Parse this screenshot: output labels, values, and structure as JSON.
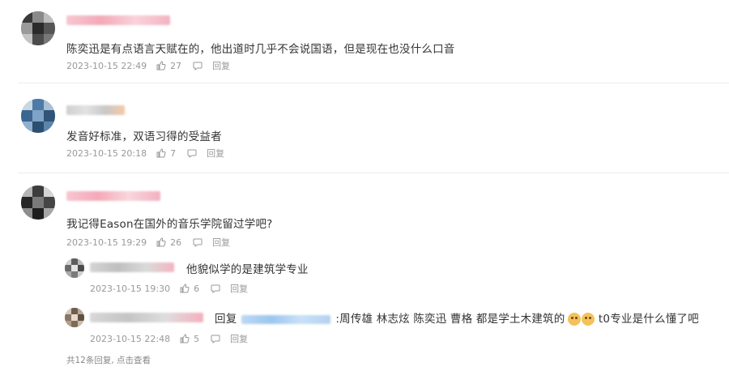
{
  "comments": [
    {
      "text": "陈奕迅是有点语言天赋在的，他出道时几乎不会说国语，但是现在也没什么口音",
      "date": "2023-10-15 22:49",
      "likes": "27",
      "reply_label": "回复"
    },
    {
      "text": "发音好标准，双语习得的受益者",
      "date": "2023-10-15 20:18",
      "likes": "7",
      "reply_label": "回复"
    },
    {
      "text": "我记得Eason在国外的音乐学院留过学吧?",
      "date": "2023-10-15 19:29",
      "likes": "26",
      "reply_label": "回复",
      "replies": [
        {
          "text": "他貌似学的是建筑学专业",
          "date": "2023-10-15 19:30",
          "likes": "6",
          "reply_label": "回复"
        },
        {
          "prefix": "回复",
          "text_before": ":周传雄 林志炫 陈奕迅 曹格 都是学土木建筑的",
          "text_after": " t0专业是什么懂了吧",
          "date": "2023-10-15 22:48",
          "likes": "5",
          "reply_label": "回复"
        }
      ],
      "more_replies": "共12条回复, 点击查看"
    }
  ],
  "colors": {
    "text": "#333333",
    "meta": "#999999",
    "divider": "#ececec",
    "name_pink": "#f6b9c6",
    "mention_blue": "#9cc6ee"
  },
  "icons": {
    "like": "thumbs-up-icon",
    "reply": "comment-bubble-icon"
  }
}
